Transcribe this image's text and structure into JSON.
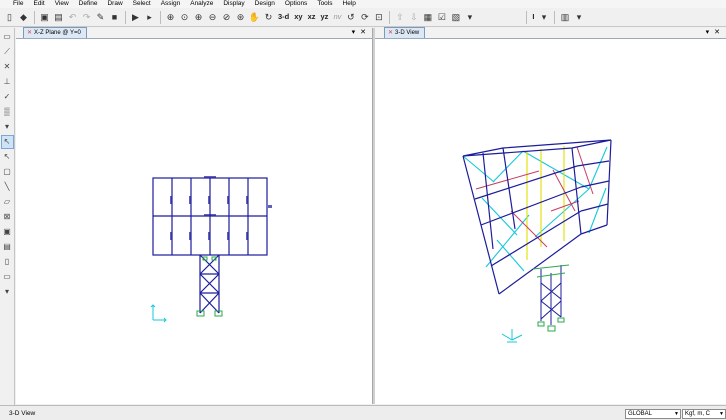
{
  "menu": [
    "File",
    "Edit",
    "View",
    "Define",
    "Draw",
    "Select",
    "Assign",
    "Analyze",
    "Display",
    "Design",
    "Options",
    "Tools",
    "Help"
  ],
  "toolbar": {
    "view_3d": "3-d",
    "view_xy": "xy",
    "view_xz": "xz",
    "view_yz": "yz",
    "view_nv": "nv",
    "section_cut": "I"
  },
  "panes": [
    {
      "title": "X-Z Plane @ Y=0"
    },
    {
      "title": "3-D View"
    }
  ],
  "status": {
    "text": "3-D View",
    "coord_system": "GLOBAL",
    "units": "Kgf, m, C"
  },
  "colors": {
    "frame": "#1c1c9c",
    "cyan": "#14c8dc",
    "yellow": "#e0e000",
    "red": "#c83c64",
    "green": "#2aa84a"
  }
}
